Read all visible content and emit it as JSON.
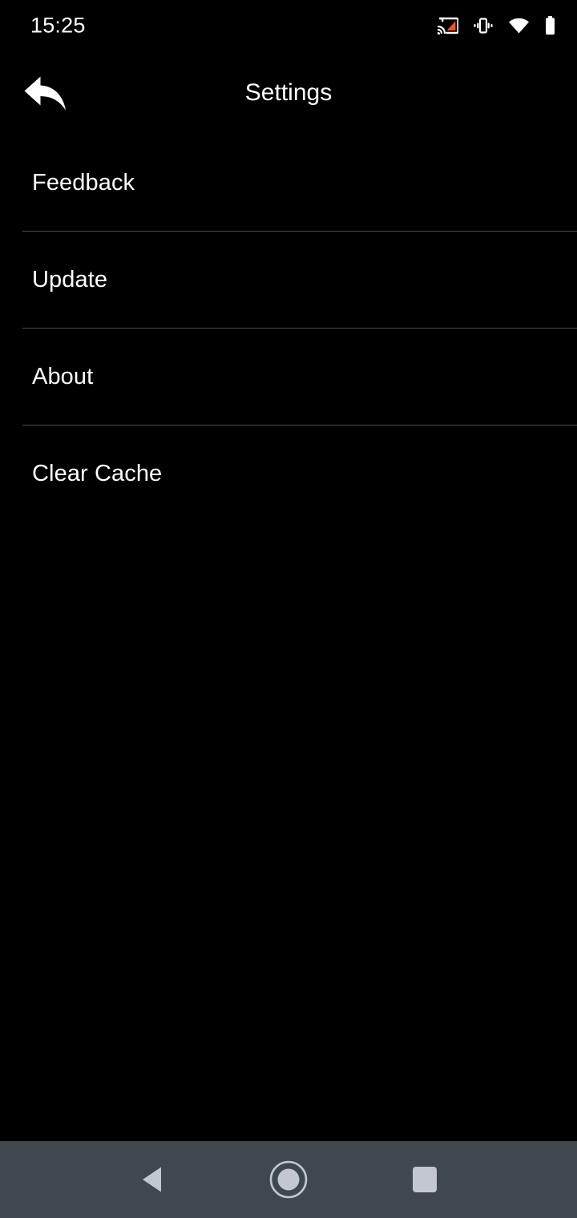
{
  "status_bar": {
    "time": "15:25",
    "icons": [
      {
        "name": "cast-icon",
        "label": "Cast",
        "color": "#f4511e"
      },
      {
        "name": "vibrate-icon",
        "label": "Vibrate",
        "color": "#ffffff"
      },
      {
        "name": "wifi-icon",
        "label": "Wi-Fi",
        "color": "#ffffff"
      },
      {
        "name": "battery-icon",
        "label": "Battery",
        "color": "#ffffff"
      }
    ]
  },
  "app_bar": {
    "back_label": "Back",
    "title": "Settings"
  },
  "settings": {
    "items": [
      {
        "label": "Feedback"
      },
      {
        "label": "Update"
      },
      {
        "label": "About"
      },
      {
        "label": "Clear Cache"
      }
    ]
  },
  "nav_bar": {
    "back_label": "Back",
    "home_label": "Home",
    "recents_label": "Recents",
    "background": "#3f474f",
    "icon_color": "#c3c8ce"
  },
  "theme": {
    "background": "#000000",
    "text": "#ffffff",
    "divider": "#4a4a4a",
    "accent": "#f4511e"
  }
}
